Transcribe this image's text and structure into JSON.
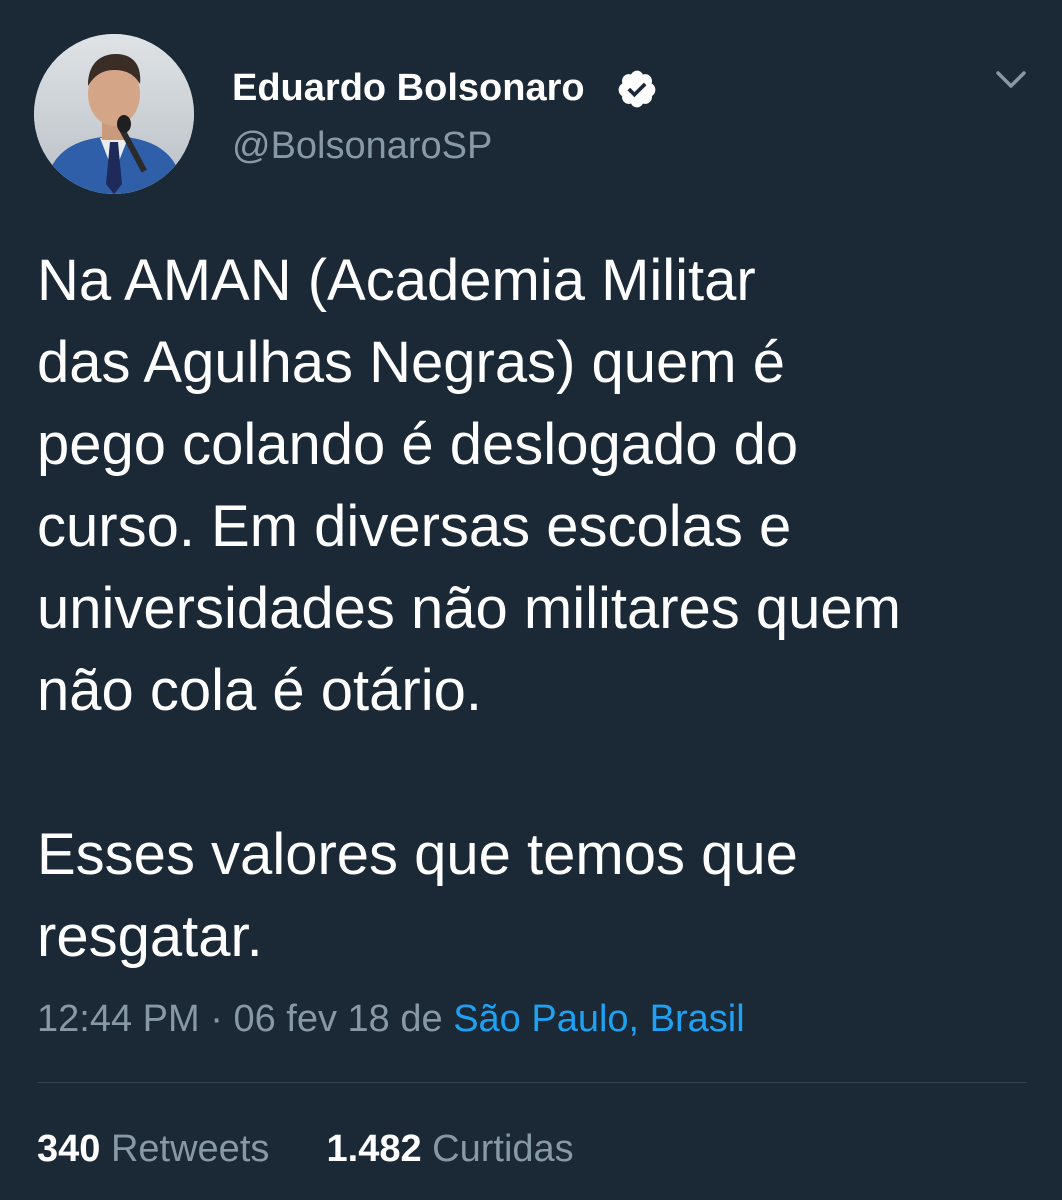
{
  "author": {
    "name": "Eduardo Bolsonaro",
    "handle": "@BolsonaroSP",
    "verified": true,
    "avatar_icon": "profile-photo-man-at-microphone"
  },
  "tweet": {
    "paragraphs": [
      "Na AMAN (Academia Militar\ndas Agulhas Negras) quem é\npego colando é deslogado do\ncurso. Em diversas escolas e\nuniversidades não militares quem\nnão cola é otário.",
      "Esses valores que temos que\nresgatar."
    ],
    "time": "12:44 PM",
    "separator": "·",
    "date": "06 fev 18",
    "via": "de",
    "location": "São Paulo, Brasil"
  },
  "stats": {
    "retweets_count": "340",
    "retweets_label": "Retweets",
    "likes_count": "1.482",
    "likes_label": "Curtidas"
  },
  "colors": {
    "background": "#1b2836",
    "primary_text": "#ffffff",
    "secondary_text": "#8899a6",
    "link": "#1da1f2",
    "divider": "#38444d"
  },
  "icons": {
    "verified": "verified-badge-icon",
    "menu": "chevron-down-icon"
  }
}
